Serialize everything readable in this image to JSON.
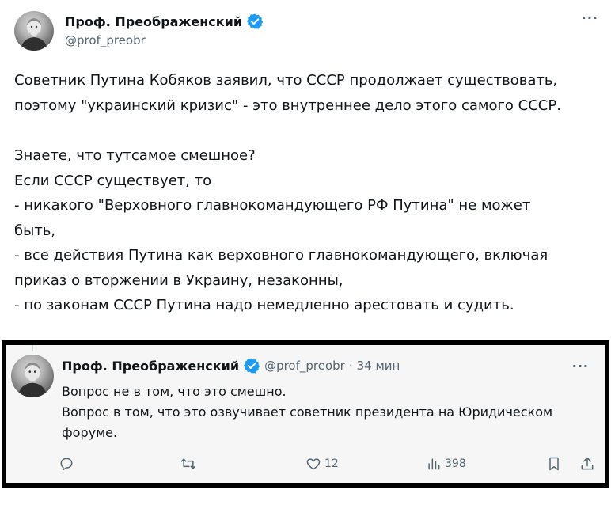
{
  "main_tweet": {
    "display_name": "Проф. Преображенский",
    "handle": "@prof_preobr",
    "more_icon": "more-horizontal-icon",
    "text_lines": [
      "Советник Путина Кобяков заявил, что СССР продолжает существовать,",
      "поэтому \"украинский кризис\" - это внутреннее дело этого самого СССР."
    ],
    "text_lines_2": [
      "Знаете, что тутсамое смешное?",
      "Если СССР существует, то",
      "- никакого \"Верховного главнокомандующего РФ Путина\" не может",
      "быть,",
      "- все действия Путина как верховного главнокомандующего, включая",
      "приказ о вторжении в Украину, незаконны,",
      "- по законам СССР Путина надо немедленно арестовать и судить."
    ]
  },
  "reply_tweet": {
    "display_name": "Проф. Преображенский",
    "handle": "@prof_preobr",
    "separator": "·",
    "time": "34 мин",
    "text_lines": [
      "Вопрос не в том, что это смешно.",
      "Вопрос в том, что это озвучивает советник президента на Юридическом",
      "форуме."
    ],
    "actions": {
      "reply_count": "",
      "retweet_count": "",
      "like_count": "12",
      "views_count": "398"
    }
  },
  "colors": {
    "verified_blue": "#1d9bf0",
    "secondary_text": "#536471",
    "frame_border": "#000000",
    "reply_background": "#f6f6f6"
  }
}
